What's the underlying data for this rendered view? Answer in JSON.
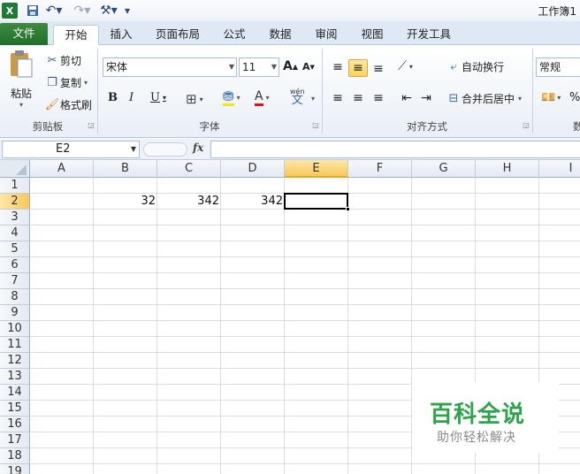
{
  "window": {
    "title": "工作簿1"
  },
  "quick_access": {
    "customize_label": "▾"
  },
  "tabs": [
    {
      "label": "文件"
    },
    {
      "label": "开始"
    },
    {
      "label": "插入"
    },
    {
      "label": "页面布局"
    },
    {
      "label": "公式"
    },
    {
      "label": "数据"
    },
    {
      "label": "审阅"
    },
    {
      "label": "视图"
    },
    {
      "label": "开发工具"
    }
  ],
  "ribbon": {
    "clipboard": {
      "paste": "粘贴",
      "cut": "剪切",
      "copy": "复制",
      "format_painter": "格式刷",
      "group_label": "剪贴板"
    },
    "font": {
      "name": "宋体",
      "size": "11",
      "bold": "B",
      "italic": "I",
      "underline": "U",
      "grow": "A",
      "shrink": "A",
      "font_color": "A",
      "phonetic_top": "wén",
      "phonetic": "文",
      "group_label": "字体"
    },
    "alignment": {
      "wrap_text": "自动换行",
      "merge_center": "合并后居中",
      "group_label": "对齐方式"
    },
    "number": {
      "format": "常规",
      "percent": "%",
      "group_label": "数"
    }
  },
  "formula_bar": {
    "name_box": "E2",
    "fx": "fx",
    "value": ""
  },
  "sheet": {
    "columns": [
      "A",
      "B",
      "C",
      "D",
      "E",
      "F",
      "G",
      "H",
      "I"
    ],
    "rows": [
      "1",
      "2",
      "3",
      "4",
      "5",
      "6",
      "7",
      "8",
      "9",
      "10",
      "11",
      "12",
      "13",
      "14",
      "15",
      "16",
      "17",
      "18",
      "19"
    ],
    "cells": {
      "B2": "32",
      "C2": "342",
      "D2": "342"
    },
    "active_cell": "E2"
  },
  "watermark": {
    "title": "百科全说",
    "subtitle": "助你轻松解决"
  },
  "colors": {
    "file_tab": "#2a7a33",
    "selection": "#ffd35a",
    "watermark_green": "#2fa34a"
  }
}
